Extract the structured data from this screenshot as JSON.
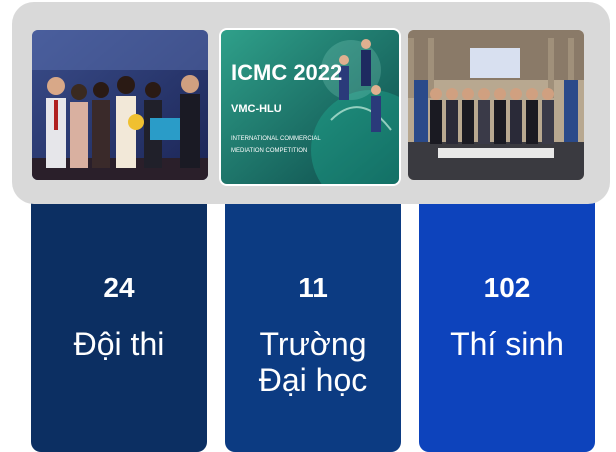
{
  "gallery": {
    "photo_middle": {
      "logo": "ICMC 2022",
      "subtitle": "VMC-HLU",
      "caption_line1": "INTERNATIONAL COMMERCIAL",
      "caption_line2": "MEDIATION COMPETITION"
    }
  },
  "stats": [
    {
      "value": "24",
      "label_lines": [
        "Đội thi"
      ]
    },
    {
      "value": "11",
      "label_lines": [
        "Trường",
        "Đại học"
      ]
    },
    {
      "value": "102",
      "label_lines": [
        "Thí sinh"
      ]
    }
  ],
  "colors": {
    "card1": "#0c2f62",
    "card2": "#0c3b82",
    "card3": "#0d43bc",
    "gallery_bg": "#d9d9d9"
  }
}
